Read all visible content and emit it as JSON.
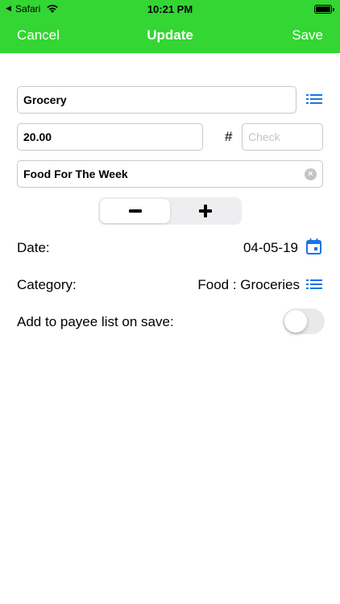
{
  "status_bar": {
    "back_arrow": "◀",
    "carrier": "Safari",
    "time": "10:21 PM"
  },
  "nav": {
    "cancel_label": "Cancel",
    "title": "Update",
    "save_label": "Save"
  },
  "form": {
    "payee_value": "Grocery",
    "amount_value": "20.00",
    "check_symbol": "#",
    "check_placeholder": "Check",
    "memo_value": "Food For The Week",
    "clear_glyph": "×"
  },
  "sign_toggle": {
    "options": [
      "minus",
      "plus"
    ],
    "selected": "minus"
  },
  "date": {
    "label": "Date:",
    "value": "04-05-19"
  },
  "category": {
    "label": "Category:",
    "value": "Food : Groceries"
  },
  "add_payee": {
    "label": "Add to payee list on save:",
    "enabled": false
  },
  "colors": {
    "nav_background": "#33d633",
    "accent": "#1a73e8"
  },
  "icons": [
    "wifi-icon",
    "battery-icon",
    "list-icon",
    "calendar-icon",
    "clear-icon"
  ]
}
